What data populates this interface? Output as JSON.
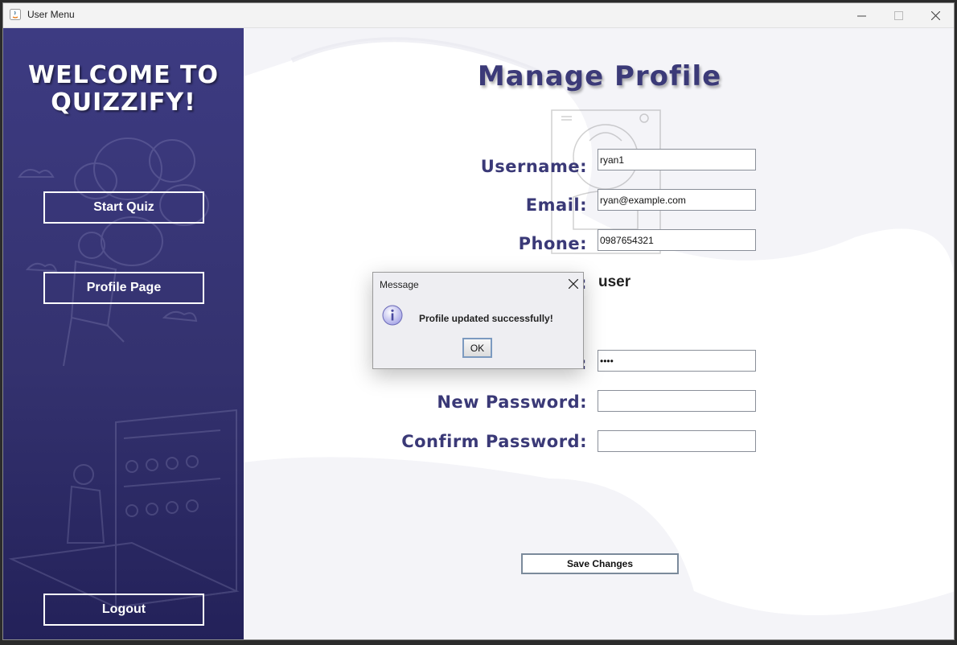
{
  "window": {
    "title": "User Menu"
  },
  "sidebar": {
    "welcome_line1": "WELCOME TO",
    "welcome_line2": "QUIZZIFY!",
    "buttons": {
      "start_quiz": "Start Quiz",
      "profile_page": "Profile Page",
      "logout": "Logout"
    }
  },
  "main": {
    "heading": "Manage Profile",
    "labels": {
      "username": "Username:",
      "email": "Email:",
      "phone": "Phone:",
      "role_colon": ":",
      "current_password_colon": ":",
      "new_password": "New Password:",
      "confirm_password": "Confirm Password:"
    },
    "fields": {
      "username": "ryan1",
      "email": "ryan@example.com",
      "phone": "0987654321",
      "current_password": "••••",
      "new_password": "",
      "confirm_password": ""
    },
    "role_value": "user",
    "save_button": "Save Changes"
  },
  "dialog": {
    "title": "Message",
    "message": "Profile updated successfully!",
    "ok_button": "OK"
  },
  "colors": {
    "sidebar": "#3d3b82",
    "heading": "#3b3a78",
    "label": "#3a3977"
  }
}
